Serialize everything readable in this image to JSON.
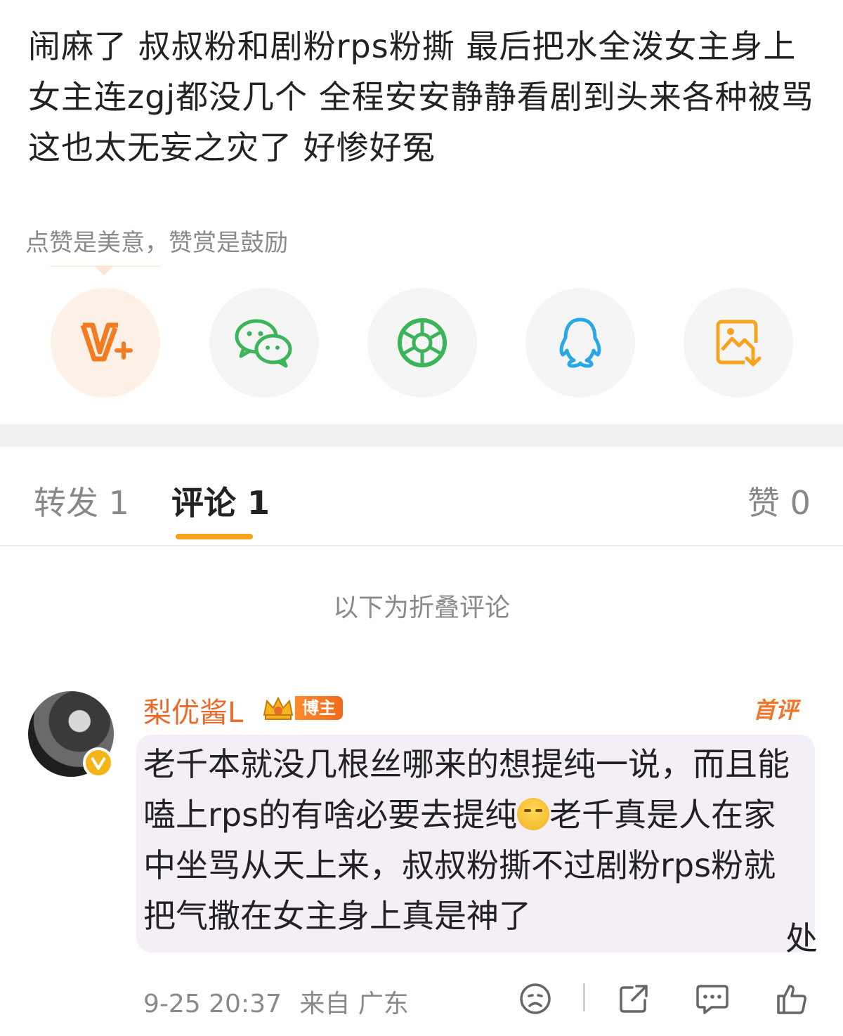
{
  "post": {
    "text": "闹麻了 叔叔粉和剧粉rps粉撕 最后把水全泼女主身上 女主连zgj都没几个 全程安安静静看剧到头来各种被骂 这也太无妄之灾了 好惨好冤"
  },
  "reward": {
    "hint": "点赞是美意，赞赏是鼓励"
  },
  "share_buttons": [
    {
      "name": "reward-v-plus-icon",
      "color": "#f47b20"
    },
    {
      "name": "wechat-icon",
      "color": "#3cb55a"
    },
    {
      "name": "moments-icon",
      "color": "#3cb55a"
    },
    {
      "name": "qq-icon",
      "color": "#2ba6e6"
    },
    {
      "name": "save-image-icon",
      "color": "#f7a31d"
    }
  ],
  "tabs": [
    {
      "label": "转发 1"
    },
    {
      "label": "评论 1"
    },
    {
      "label": "赞 0"
    }
  ],
  "folded_note": "以下为折叠评论",
  "comment": {
    "user_name": "梨优酱L",
    "badge": "博主",
    "first_tag": "首评",
    "text_part1": "老千本就没几根丝哪来的想提纯一说，而且能嗑上rps的有啥必要去提纯",
    "emoji": "smirk-emoji",
    "text_part2": "老千真是人在家中坐骂从天上来，叔叔粉撕不过剧粉rps粉就把气撒在女主身上真是神了",
    "corner_mark": "处",
    "time": "9-25 20:37",
    "location": "来自 广东"
  },
  "colors": {
    "accent": "#f7a31d",
    "username": "#e8692a",
    "bubble": "#f4eef6"
  }
}
